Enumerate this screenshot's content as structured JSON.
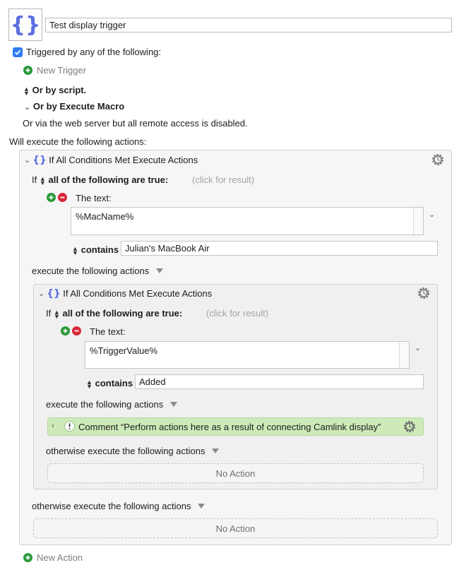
{
  "macro": {
    "name": "Test display trigger",
    "icon": "curly-braces-icon"
  },
  "triggers": {
    "checkbox_label": "Triggered by any of the following:",
    "new_trigger": "New Trigger",
    "or_by_script": "Or by script.",
    "or_by_execute_macro": "Or by Execute Macro",
    "web_server_note": "Or via the web server but all remote access is disabled."
  },
  "will_execute": "Will execute the following actions:",
  "outer_if": {
    "title": "If All Conditions Met Execute Actions",
    "if_prefix": "If",
    "condition_mode": "all of the following are true:",
    "click_result": "(click for result)",
    "condition_label": "The text:",
    "text_value": "%MacName%",
    "operator": "contains",
    "operand": "Julian's MacBook Air",
    "execute_label": "execute the following actions",
    "otherwise_label": "otherwise execute the following actions",
    "no_action": "No Action"
  },
  "inner_if": {
    "title": "If All Conditions Met Execute Actions",
    "if_prefix": "If",
    "condition_mode": "all of the following are true:",
    "click_result": "(click for result)",
    "condition_label": "The text:",
    "text_value": "%TriggerValue%",
    "operator": "contains",
    "operand": "Added",
    "execute_label": "execute the following actions",
    "comment": "Comment “Perform actions here as a result of connecting Camlink display”",
    "otherwise_label": "otherwise execute the following actions",
    "no_action": "No Action"
  },
  "new_action": "New Action",
  "colors": {
    "accent_blue": "#2d7cf6",
    "add_green": "#2a9a3a",
    "remove_red": "#d9283a",
    "comment_green": "#cdeab8",
    "icon_purple": "#5b6ee1"
  }
}
